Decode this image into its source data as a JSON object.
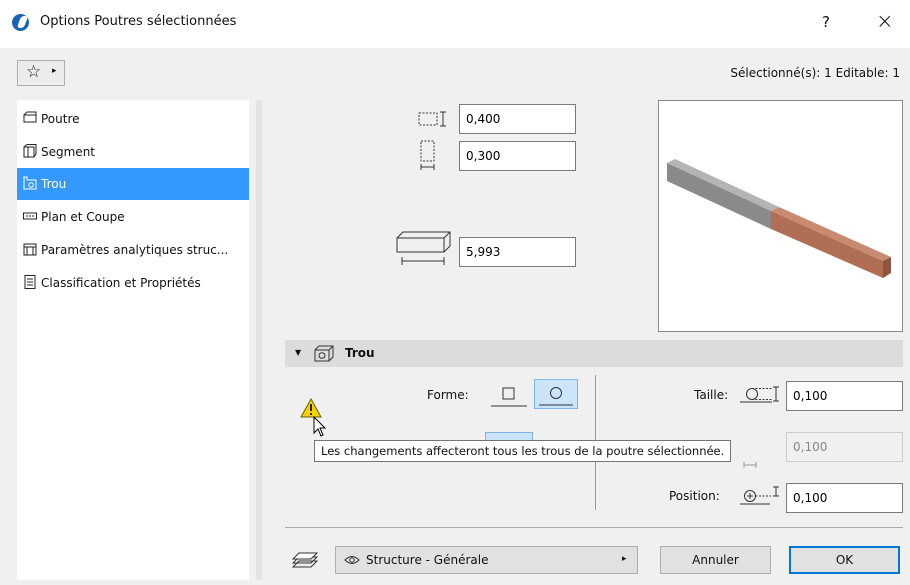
{
  "window": {
    "title": "Options Poutres sélectionnées",
    "help": "?",
    "close": "×"
  },
  "toolbar": {
    "favorites_star": "☆",
    "favorites_arrow": "▸",
    "selection_info": "Sélectionné(s): 1 Editable: 1"
  },
  "sidebar": {
    "items": [
      {
        "label": "Poutre",
        "icon": "beam-icon"
      },
      {
        "label": "Segment",
        "icon": "segment-icon"
      },
      {
        "label": "Trou",
        "icon": "hole-icon",
        "selected": true
      },
      {
        "label": "Plan et Coupe",
        "icon": "plan-section-icon"
      },
      {
        "label": "Paramètres analytiques struc...",
        "icon": "analytic-params-icon"
      },
      {
        "label": "Classification et Propriétés",
        "icon": "classification-icon"
      }
    ]
  },
  "dimensions": {
    "height": "0,400",
    "width": "0,300",
    "length": "5,993"
  },
  "hole_section": {
    "title": "Trou",
    "forme_label": "Forme:",
    "taille_label": "Taille:",
    "taille_value": "0,100",
    "second_value": "0,100",
    "position_label": "Position:",
    "position_value": "0,100",
    "selected_shape": "circle"
  },
  "tooltip": {
    "text": "Les changements affecteront tous les trous de la poutre sélectionnée."
  },
  "footer": {
    "favorites_label": "Structure - Générale",
    "favorites_arrow": "▸",
    "cancel": "Annuler",
    "ok": "OK"
  },
  "colors": {
    "accent": "#3399ff",
    "preview_grey": "#8a8a8a",
    "preview_brick": "#b06f55",
    "warning": "#f5d300"
  }
}
